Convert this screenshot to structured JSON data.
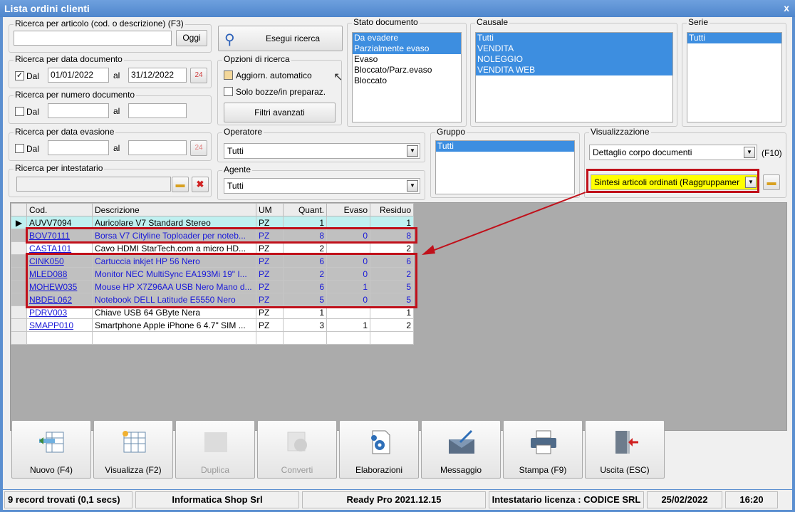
{
  "window": {
    "title": "Lista ordini clienti",
    "close": "x"
  },
  "search_article": {
    "label": "Ricerca per articolo (cod. o descrizione) (F3)",
    "value": "",
    "today_btn": "Oggi"
  },
  "execute_btn": "Esegui ricerca",
  "doc_date": {
    "label": "Ricerca per data documento",
    "dal": "Dal",
    "al": "al",
    "from": "01/01/2022",
    "to": "31/12/2022",
    "checked": true
  },
  "doc_number": {
    "label": "Ricerca per numero documento",
    "dal": "Dal",
    "al": "al",
    "from": "",
    "to": ""
  },
  "evasion_date": {
    "label": "Ricerca per data evasione",
    "dal": "Dal",
    "al": "al",
    "from": "",
    "to": ""
  },
  "holder": {
    "label": "Ricerca per intestatario",
    "value": ""
  },
  "options": {
    "label": "Opzioni di ricerca",
    "auto_update": "Aggiorn. automatico",
    "drafts": "Solo bozze/in preparaz.",
    "advanced": "Filtri avanzati"
  },
  "doc_state": {
    "label": "Stato documento",
    "items": [
      "Da evadere",
      "Parzialmente evaso",
      "Evaso",
      "Bloccato/Parz.evaso",
      "Bloccato"
    ],
    "selected": [
      0,
      1
    ]
  },
  "causale": {
    "label": "Causale",
    "items": [
      "Tutti",
      "VENDITA",
      "NOLEGGIO",
      "VENDITA WEB"
    ]
  },
  "serie": {
    "label": "Serie",
    "items": [
      "Tutti"
    ]
  },
  "operatore": {
    "label": "Operatore",
    "value": "Tutti"
  },
  "agente": {
    "label": "Agente",
    "value": "Tutti"
  },
  "gruppo": {
    "label": "Gruppo",
    "items": [
      "Tutti"
    ]
  },
  "visualizzazione": {
    "label": "Visualizzazione",
    "value": "Dettaglio corpo documenti",
    "shortcut": "(F10)",
    "summary": "Sintesi articoli ordinati (Raggruppamer"
  },
  "grid": {
    "headers": [
      "Cod.",
      "Descrizione",
      "UM",
      "Quant.",
      "Evaso",
      "Residuo"
    ],
    "rows": [
      {
        "code": "AUVV7094",
        "desc": "Auricolare V7 Standard Stereo",
        "um": "PZ",
        "qty": "1",
        "evaso": "",
        "res": "1"
      },
      {
        "code": "BOV70111",
        "desc": "Borsa V7 Cityline Toploader per noteb...",
        "um": "PZ",
        "qty": "8",
        "evaso": "0",
        "res": "8"
      },
      {
        "code": "CASTA101",
        "desc": "Cavo HDMI StarTech.com a micro HD...",
        "um": "PZ",
        "qty": "2",
        "evaso": "",
        "res": "2"
      },
      {
        "code": "CINK050",
        "desc": "Cartuccia inkjet HP 56 Nero",
        "um": "PZ",
        "qty": "6",
        "evaso": "0",
        "res": "6"
      },
      {
        "code": "MLED088",
        "desc": "Monitor NEC MultiSync EA193Mi 19\" I...",
        "um": "PZ",
        "qty": "2",
        "evaso": "0",
        "res": "2"
      },
      {
        "code": "MOHEW035",
        "desc": "Mouse HP X7Z96AA USB Nero Mano d...",
        "um": "PZ",
        "qty": "6",
        "evaso": "1",
        "res": "5"
      },
      {
        "code": "NBDEL062",
        "desc": "Notebook DELL Latitude E5550 Nero",
        "um": "PZ",
        "qty": "5",
        "evaso": "0",
        "res": "5"
      },
      {
        "code": "PDRV003",
        "desc": "Chiave USB 64 GByte Nera",
        "um": "PZ",
        "qty": "1",
        "evaso": "",
        "res": "1"
      },
      {
        "code": "SMAPP010",
        "desc": "Smartphone Apple iPhone 6 4.7\" SIM ...",
        "um": "PZ",
        "qty": "3",
        "evaso": "1",
        "res": "2"
      }
    ]
  },
  "toolbar": [
    {
      "label": "Nuovo (F4)",
      "icon": "new-doc-icon",
      "enabled": true
    },
    {
      "label": "Visualizza (F2)",
      "icon": "view-grid-icon",
      "enabled": true
    },
    {
      "label": "Duplica",
      "icon": "duplicate-icon",
      "enabled": false
    },
    {
      "label": "Converti",
      "icon": "convert-icon",
      "enabled": false
    },
    {
      "label": "Elaborazioni",
      "icon": "gear-doc-icon",
      "enabled": true
    },
    {
      "label": "Messaggio",
      "icon": "message-icon",
      "enabled": true
    },
    {
      "label": "Stampa (F9)",
      "icon": "printer-icon",
      "enabled": true
    },
    {
      "label": "Uscita (ESC)",
      "icon": "exit-icon",
      "enabled": true
    }
  ],
  "status": {
    "records": "9 record trovati (0,1 secs)",
    "company": "Informatica Shop Srl",
    "version": "Ready Pro 2021.12.15",
    "license": "Intestatario licenza : CODICE SRL",
    "date": "25/02/2022",
    "time": "16:20"
  },
  "colors": {
    "accent": "#c0101a",
    "selection": "#3d8ee0",
    "highlight": "#ffff00"
  }
}
